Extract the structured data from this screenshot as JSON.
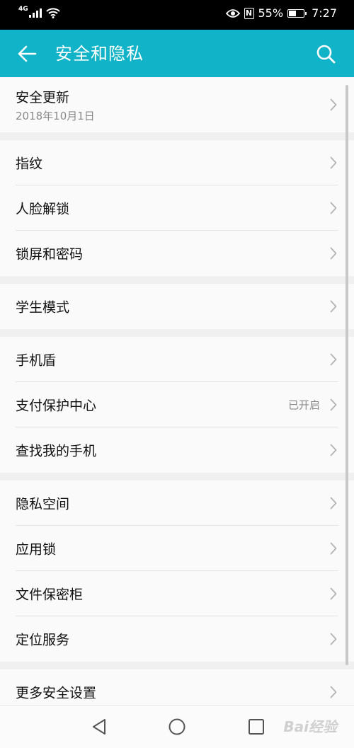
{
  "status_bar": {
    "network": "4G",
    "battery_percent": "55%",
    "battery_level": 0.55,
    "time": "7:27",
    "nfc": "N"
  },
  "app_bar": {
    "title": "安全和隐私",
    "back_icon": "arrow-left-icon",
    "search_icon": "search-icon"
  },
  "groups": [
    {
      "items": [
        {
          "label": "安全更新",
          "sub": "2018年10月1日"
        }
      ]
    },
    {
      "items": [
        {
          "label": "指纹"
        },
        {
          "label": "人脸解锁"
        },
        {
          "label": "锁屏和密码"
        }
      ]
    },
    {
      "items": [
        {
          "label": "学生模式"
        }
      ]
    },
    {
      "items": [
        {
          "label": "手机盾"
        },
        {
          "label": "支付保护中心",
          "value": "已开启"
        },
        {
          "label": "查找我的手机"
        }
      ]
    },
    {
      "items": [
        {
          "label": "隐私空间"
        },
        {
          "label": "应用锁"
        },
        {
          "label": "文件保密柜"
        },
        {
          "label": "定位服务"
        }
      ]
    },
    {
      "items": [
        {
          "label": "更多安全设置"
        }
      ]
    }
  ],
  "nav_bar": {
    "back_icon": "triangle-back-icon",
    "home_icon": "circle-home-icon",
    "recents_icon": "square-recents-icon",
    "watermark": "Bai经验"
  },
  "colors": {
    "accent": "#11b3c9",
    "status_bar": "#000000",
    "background": "#f2f2f2"
  }
}
